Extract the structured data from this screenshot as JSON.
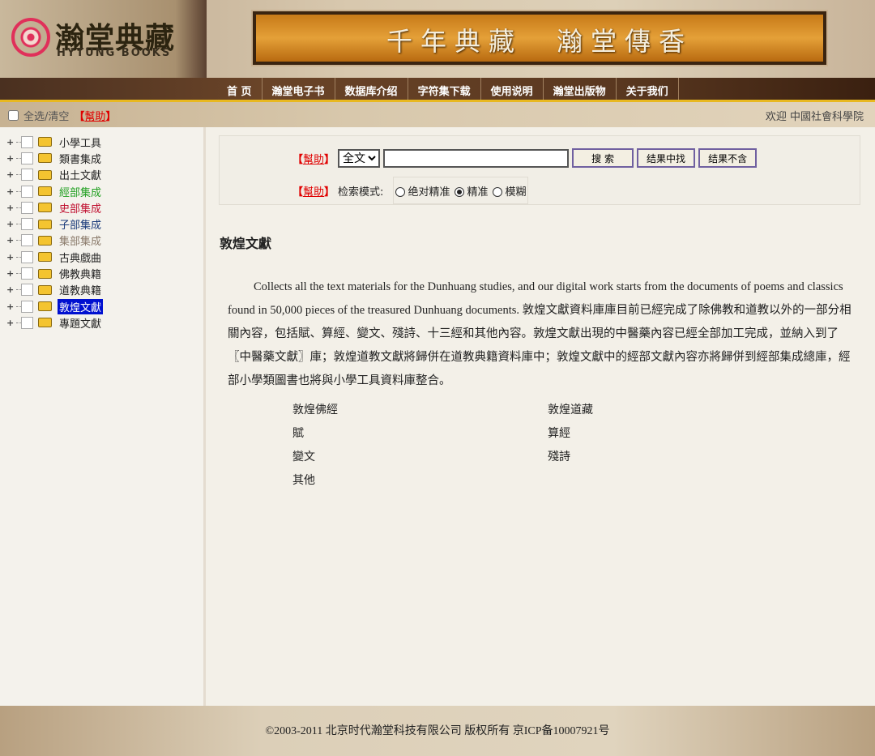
{
  "header": {
    "logo_cn": "瀚堂典藏",
    "logo_en": "HYTUNG BOOKS",
    "slogan": "千年典藏　瀚堂傳香"
  },
  "nav": [
    "首 页",
    "瀚堂电子书",
    "数据库介绍",
    "字符集下载",
    "使用说明",
    "瀚堂出版物",
    "关于我们"
  ],
  "subbar": {
    "select_all": "全选/清空",
    "help": "幫助",
    "welcome": "欢迎  中國社會科學院"
  },
  "tree": [
    {
      "label": "小學工具",
      "color": "#222"
    },
    {
      "label": "類書集成",
      "color": "#222"
    },
    {
      "label": "出土文獻",
      "color": "#222"
    },
    {
      "label": "經部集成",
      "color": "#22a022"
    },
    {
      "label": "史部集成",
      "color": "#c01030"
    },
    {
      "label": "子部集成",
      "color": "#1a3a7a"
    },
    {
      "label": "集部集成",
      "color": "#8a7a6a"
    },
    {
      "label": "古典戲曲",
      "color": "#222"
    },
    {
      "label": "佛教典籍",
      "color": "#222"
    },
    {
      "label": "道教典籍",
      "color": "#222"
    },
    {
      "label": "敦煌文獻",
      "color": "#fff",
      "selected": true
    },
    {
      "label": "專題文獻",
      "color": "#222"
    }
  ],
  "search": {
    "help": "幫助",
    "scope": "全文",
    "query": "",
    "search_btn": "搜 索",
    "within_btn": "结果中找",
    "exclude_btn": "结果不含",
    "mode_label": "检索模式:",
    "modes": [
      "绝对精准",
      "精准",
      "模糊"
    ],
    "selected_mode": "精准"
  },
  "content": {
    "title": "敦煌文獻",
    "description": "Collects all the text materials for the Dunhuang studies, and our digital work starts from the documents of poems and classics found in 50,000 pieces of the treasured Dunhuang documents. 敦煌文獻資料庫庫目前已經完成了除佛教和道教以外的一部分相關內容，包括賦、算經、變文、殘詩、十三經和其他內容。敦煌文獻出現的中醫藥內容已經全部加工完成，並納入到了〖中醫藥文獻〗庫；敦煌道教文獻將歸併在道教典籍資料庫中；敦煌文獻中的經部文獻內容亦將歸併到經部集成總庫，經部小學類圖書也將與小學工具資料庫整合。",
    "links": [
      "敦煌佛經",
      "敦煌道藏",
      "賦",
      "算經",
      "變文",
      "殘詩",
      "其他"
    ]
  },
  "footer": "©2003-2011 北京时代瀚堂科技有限公司 版权所有 京ICP备10007921号"
}
